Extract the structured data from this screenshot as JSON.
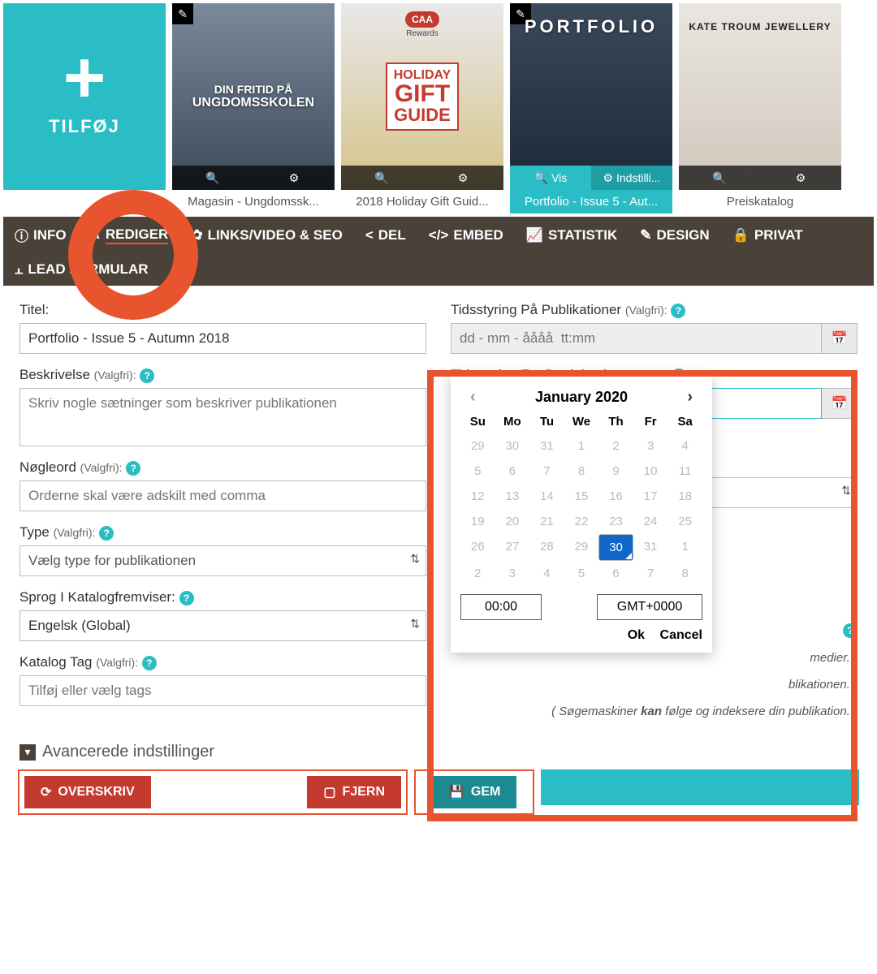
{
  "add_label": "TILFØJ",
  "pubs": [
    {
      "title": "Magasin - Ungdomssk...",
      "cover_line1": "DIN FRITID PÅ",
      "cover_line2": "UNGDOMSSKOLEN",
      "badge": true
    },
    {
      "title": "2018 Holiday Gift Guid...",
      "cover_brand": "CAA",
      "cover_sub": "Rewards",
      "cover_box1": "HOLIDAY",
      "cover_box2": "GIFT",
      "cover_box3": "GUIDE"
    },
    {
      "title": "Portfolio - Issue 5 - Aut...",
      "cover_line1": "PORTFOLIO",
      "badge": true,
      "selected": true,
      "view": "Vis",
      "settings": "Indstilli..."
    },
    {
      "title": "Preiskatalog",
      "cover_line1": "KATE TROUM JEWELLERY"
    }
  ],
  "tabs": {
    "info": "INFO",
    "rediger": "REDIGER",
    "links": "LINKS/VIDEO & SEO",
    "del": "DEL",
    "embed": "EMBED",
    "stat": "STATISTIK",
    "design": "DESIGN",
    "privat": "PRIVAT",
    "lead": "LEAD FORMULAR"
  },
  "left": {
    "titel_label": "Titel:",
    "titel_value": "Portfolio - Issue 5 - Autumn 2018",
    "besk_label": "Beskrivelse",
    "besk_placeholder": "Skriv nogle sætninger som beskriver publikationen",
    "nogle_label": "Nøgleord",
    "nogle_placeholder": "Orderne skal være adskilt med comma",
    "type_label": "Type",
    "type_placeholder": "Vælg type for publikationen",
    "sprog_label": "Sprog I Katalogfremviser:",
    "sprog_value": "Engelsk (Global)",
    "tag_label": "Katalog Tag",
    "tag_placeholder": "Tilføj eller vælg tags",
    "valgfri": "(Valgfri):"
  },
  "right": {
    "ts_pub_label": "Tidsstyring På Publikationer",
    "ts_deact_label": "Tidsstyring For Deaktivering",
    "date_placeholder": "dd - mm - åååå  tt:mm",
    "valgfri": "(Valgfri):",
    "hint1_a": "medier. )",
    "hint2_a": "blikationen. )",
    "hint3_a": "( Søgemaskiner ",
    "hint3_b": "kan",
    "hint3_c": " følge og indeksere din publikation. )"
  },
  "calendar": {
    "title": "January 2020",
    "dow": [
      "Su",
      "Mo",
      "Tu",
      "We",
      "Th",
      "Fr",
      "Sa"
    ],
    "days": [
      29,
      30,
      31,
      1,
      2,
      3,
      4,
      5,
      6,
      7,
      8,
      9,
      10,
      11,
      12,
      13,
      14,
      15,
      16,
      17,
      18,
      19,
      20,
      21,
      22,
      23,
      24,
      25,
      26,
      27,
      28,
      29,
      30,
      31,
      1,
      2,
      3,
      4,
      5,
      6,
      7,
      8
    ],
    "selected_index": 32,
    "time": "00:00",
    "tz": "GMT+0000",
    "ok": "Ok",
    "cancel": "Cancel"
  },
  "adv_label": "Avancerede indstillinger",
  "actions": {
    "overskriv": "OVERSKRIV",
    "fjern": "FJERN",
    "gem": "GEM"
  }
}
